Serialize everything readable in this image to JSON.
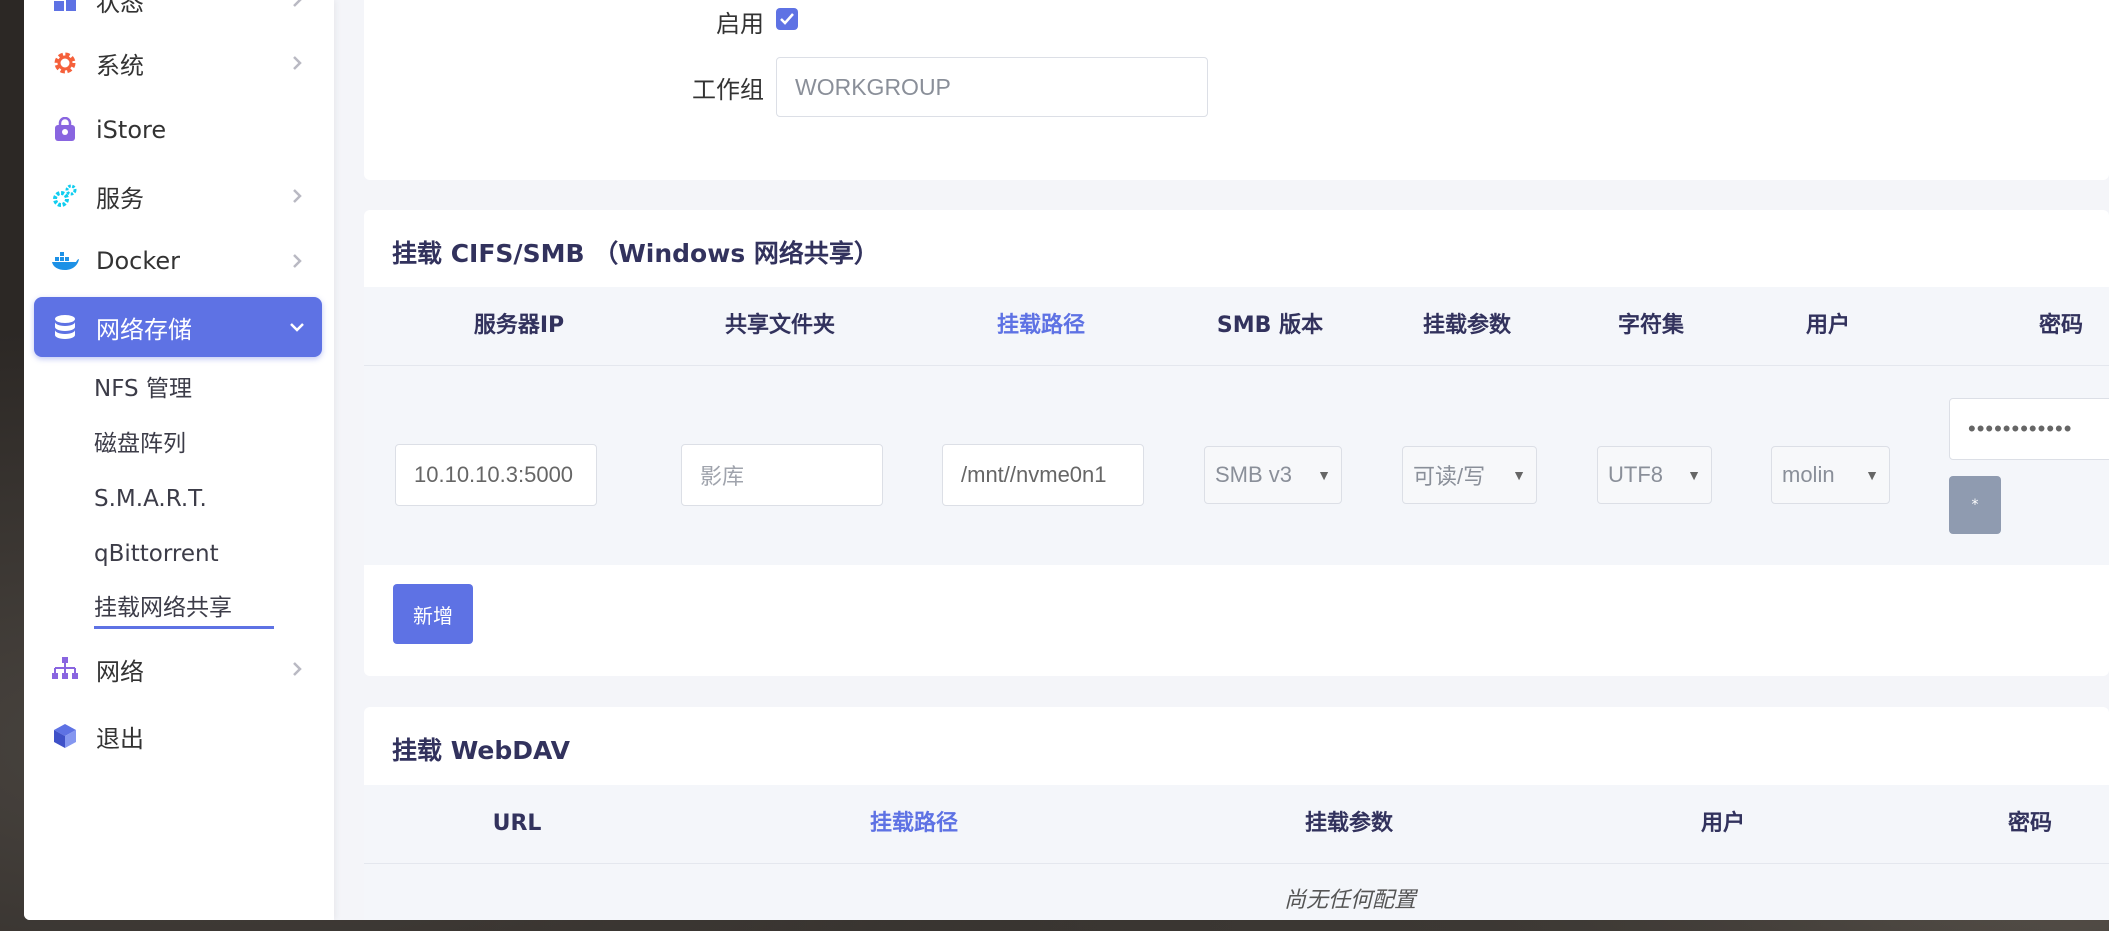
{
  "sidebar": {
    "items": [
      {
        "label": "状态",
        "icon": "dashboard-icon",
        "has_children": true
      },
      {
        "label": "系统",
        "icon": "gear-icon",
        "has_children": true
      },
      {
        "label": "iStore",
        "icon": "store-bag-icon",
        "has_children": false
      },
      {
        "label": "服务",
        "icon": "services-gears-icon",
        "has_children": true
      },
      {
        "label": "Docker",
        "icon": "docker-whale-icon",
        "has_children": true
      },
      {
        "label": "网络存储",
        "icon": "database-icon",
        "has_children": true,
        "active": true
      },
      {
        "label": "网络",
        "icon": "network-sitemap-icon",
        "has_children": true
      },
      {
        "label": "退出",
        "icon": "logout-cube-icon",
        "has_children": false
      }
    ],
    "subitems": [
      "NFS 管理",
      "磁盘阵列",
      "S.M.A.R.T.",
      "qBittorrent",
      "挂载网络共享"
    ],
    "current_subitem": "挂载网络共享"
  },
  "global": {
    "enable_label": "启用",
    "enable_checked": true,
    "workgroup_label": "工作组",
    "workgroup_placeholder": "WORKGROUP"
  },
  "cifs": {
    "title": "挂载 CIFS/SMB （Windows 网络共享）",
    "columns": [
      "服务器IP",
      "共享文件夹",
      "挂载路径",
      "SMB 版本",
      "挂载参数",
      "字符集",
      "用户",
      "密码"
    ],
    "row": {
      "server_ip": "10.10.10.3:5000",
      "share_folder_placeholder": "影库",
      "mount_path": "/mnt//nvme0n1",
      "smb_version": "SMB v3",
      "mount_options": "可读/写",
      "charset": "UTF8",
      "user": "molin",
      "password_mask": "••••••••••••",
      "reveal_button": "*"
    },
    "add_button": "新增"
  },
  "webdav": {
    "title": "挂载 WebDAV",
    "columns": [
      "URL",
      "挂载路径",
      "挂载参数",
      "用户",
      "密码"
    ],
    "empty_text": "尚无任何配置"
  },
  "colors": {
    "accent": "#5e72e4",
    "page_bg": "#f4f5f9",
    "text_dark": "#32325d"
  }
}
